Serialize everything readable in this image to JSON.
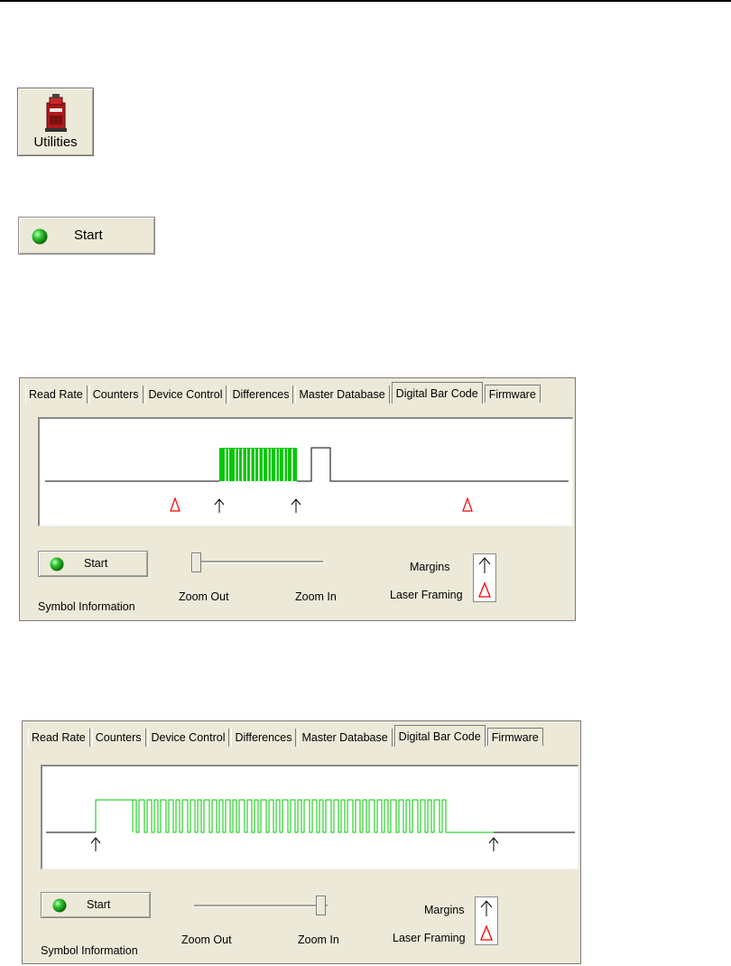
{
  "utilities_button": {
    "label": "Utilities"
  },
  "start_button": {
    "label": "Start"
  },
  "panels": [
    {
      "tabs": [
        "Read Rate",
        "Counters",
        "Device Control",
        "Differences",
        "Master Database",
        "Digital Bar Code",
        "Firmware"
      ],
      "active_tab": "Digital Bar Code",
      "start_label": "Start",
      "symbol_information": "Symbol Information",
      "zoom_out_label": "Zoom Out",
      "zoom_in_label": "Zoom In",
      "zoom_level": 0.0,
      "margins_label": "Margins",
      "laser_framing_label": "Laser Framing"
    },
    {
      "tabs": [
        "Read Rate",
        "Counters",
        "Device Control",
        "Differences",
        "Master Database",
        "Digital Bar Code",
        "Firmware"
      ],
      "active_tab": "Digital Bar Code",
      "start_label": "Start",
      "symbol_information": "Symbol Information",
      "zoom_out_label": "Zoom Out",
      "zoom_in_label": "Zoom In",
      "zoom_level": 1.0,
      "margins_label": "Margins",
      "laser_framing_label": "Laser Framing"
    }
  ],
  "colors": {
    "signal_green": "#00c800",
    "laser_framing_red": "#ff0000",
    "led_green": "#22aa22"
  },
  "icons": {
    "utilities": "utilities-cabinet-icon",
    "led": "green-led-icon",
    "margin": "margin-arrow-icon",
    "laser": "laser-framing-delta-icon"
  }
}
